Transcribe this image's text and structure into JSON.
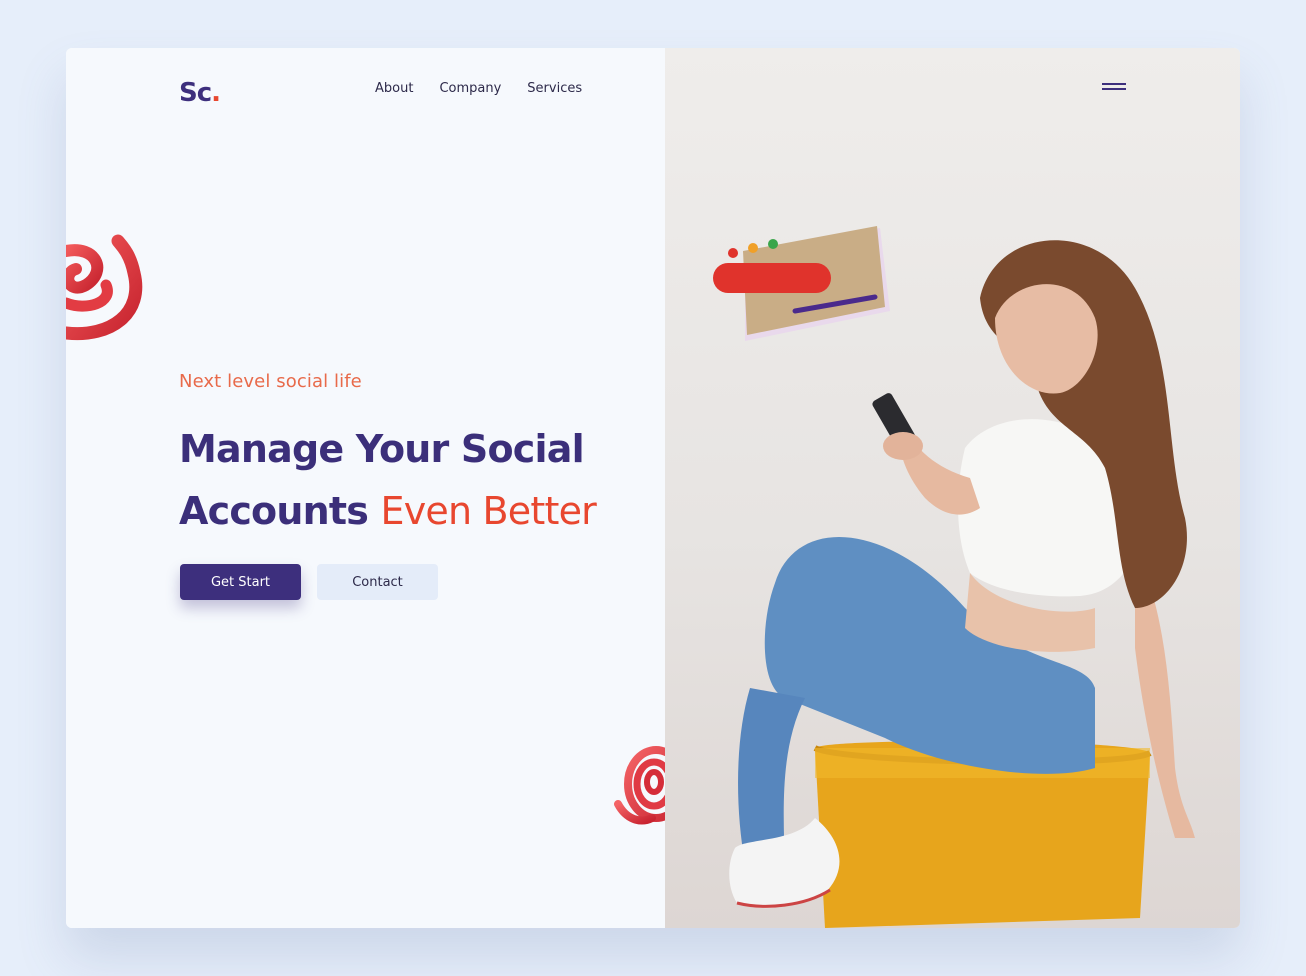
{
  "brand": {
    "logo_text": "Sc",
    "logo_dot": "."
  },
  "nav": {
    "items": [
      "About",
      "Company",
      "Services"
    ]
  },
  "hero": {
    "tagline": "Next level social life",
    "headline_line1": "Manage Your Social",
    "headline_line2_main": "Accounts",
    "headline_line2_accent": "Even Better",
    "primary_button": "Get Start",
    "secondary_button": "Contact"
  },
  "icons": {
    "menu": "hamburger-menu-icon",
    "spiral": "spiral-decoration"
  },
  "colors": {
    "primary": "#3d2f7d",
    "accent": "#e8472f",
    "tagline": "#e86a4a",
    "background": "#e6eefa",
    "card": "#f6f9fd",
    "button_secondary": "#e4ecf9"
  }
}
